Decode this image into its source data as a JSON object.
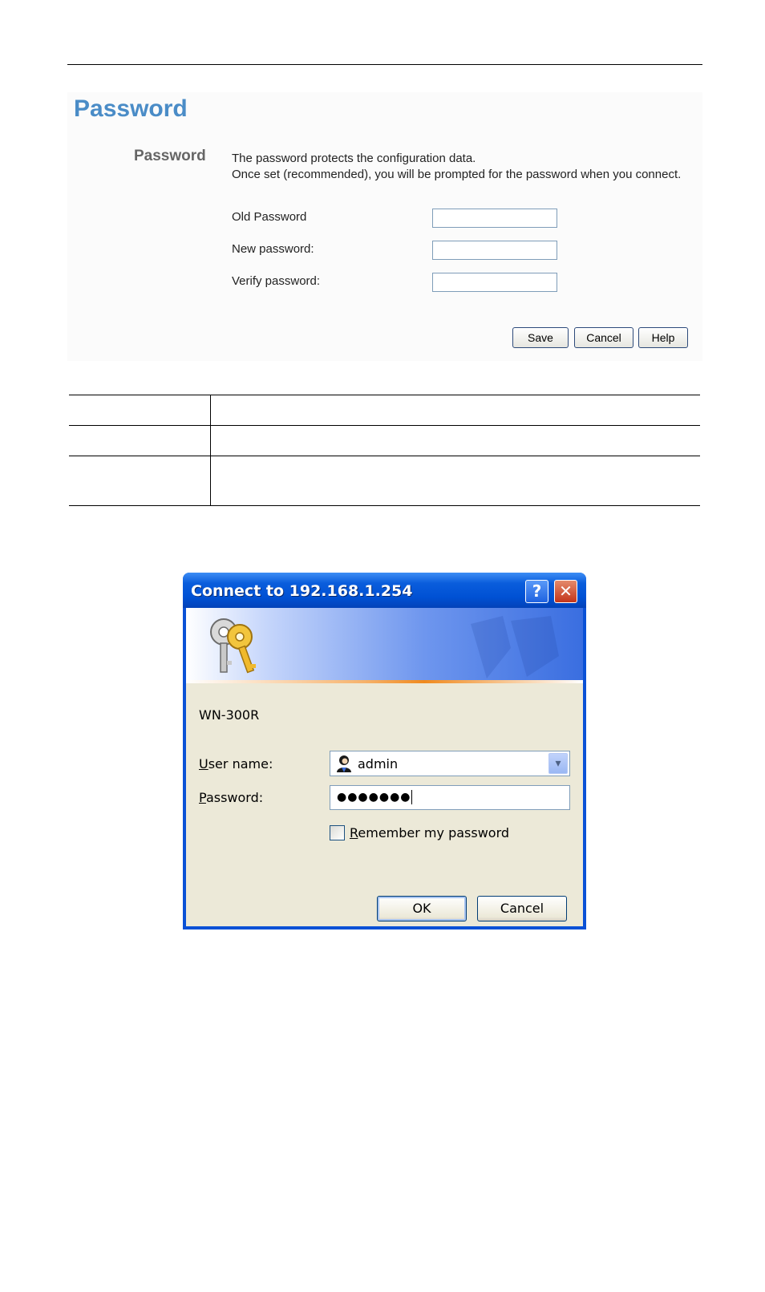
{
  "router_page": {
    "title": "Password",
    "section_label": "Password",
    "description_line1": "The password protects the configuration data.",
    "description_line2": "Once set (recommended), you will be prompted for the password when you connect.",
    "fields": [
      {
        "label": "Old Password",
        "value": ""
      },
      {
        "label": "New password:",
        "value": ""
      },
      {
        "label": "Verify password:",
        "value": ""
      }
    ],
    "buttons": {
      "save": "Save",
      "cancel": "Cancel",
      "help": "Help"
    }
  },
  "login_dialog": {
    "title": "Connect to 192.168.1.254",
    "help_glyph": "?",
    "close_glyph": "✕",
    "site_name": "WN-300R",
    "username_label_accel": "U",
    "username_label_rest": "ser name:",
    "username_value": "admin",
    "password_label_accel": "P",
    "password_label_rest": "assword:",
    "password_value": "●●●●●●●",
    "remember_accel": "R",
    "remember_rest": "emember my password",
    "remember_checked": false,
    "ok_label": "OK",
    "cancel_label": "Cancel",
    "icons": [
      "keys-icon",
      "user-icon",
      "chevron-down-icon",
      "help-icon",
      "close-icon"
    ]
  },
  "colors": {
    "title_blue": "#4a8cc7",
    "xp_title_blue": "#0a51d6",
    "xp_face": "#ece9d8"
  }
}
